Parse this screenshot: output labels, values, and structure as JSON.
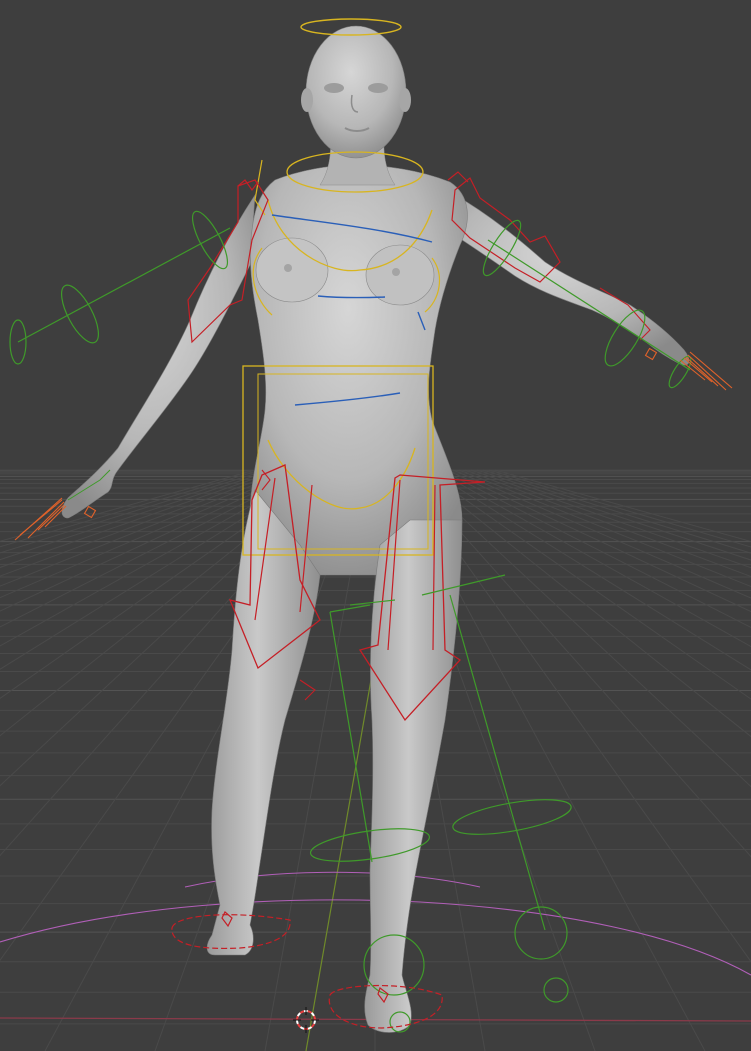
{
  "viewport": {
    "mode": "3d-viewport",
    "background_color": "#3e3e3e",
    "grid_color": "#4a4a4a",
    "grid_color_major": "#535353",
    "axis_x_color": "#8b3a4a",
    "axis_y_color": "#6f8a2a",
    "ground_circle_color": "#b15fb8"
  },
  "model": {
    "skin_color": "#b9b9b9",
    "skin_shadow": "#8e8e8e",
    "skin_highlight": "#d4d4d4"
  },
  "rig": {
    "control_yellow": "#d8b520",
    "control_red": "#c51f26",
    "control_green": "#3f9a2a",
    "control_blue": "#2a5fb8",
    "control_orange": "#e0622a"
  },
  "cursor": {
    "icon": "3d-cursor-icon",
    "color_a": "#e84040",
    "color_b": "#ffffff"
  }
}
